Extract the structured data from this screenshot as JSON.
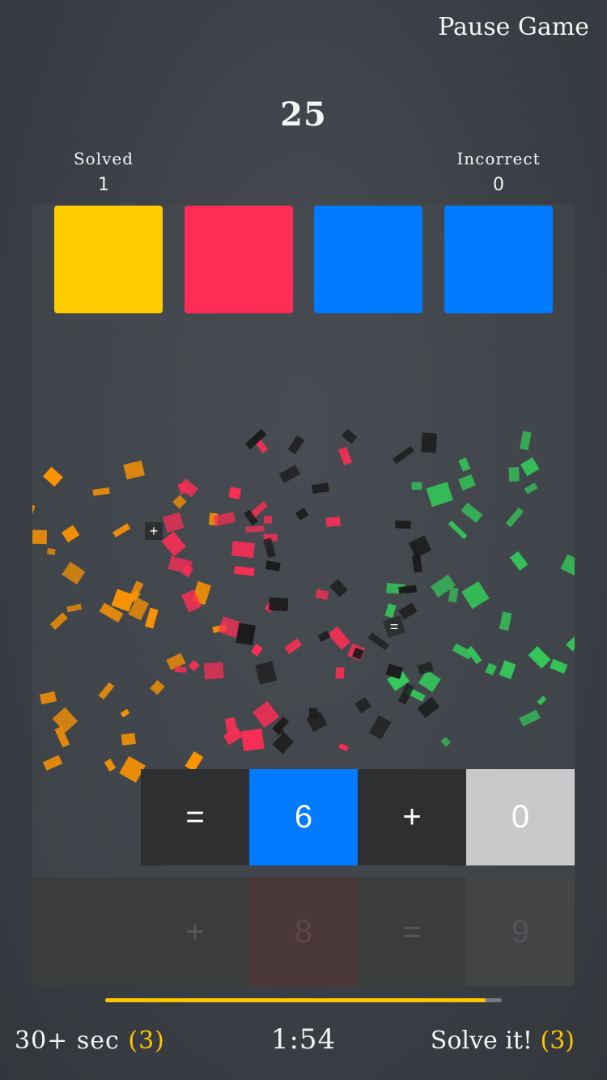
{
  "header": {
    "pause_label": "Pause Game",
    "score": "25"
  },
  "stats": {
    "solved_label": "Solved",
    "solved_value": "1",
    "incorrect_label": "Incorrect",
    "incorrect_value": "0"
  },
  "targets": [
    {
      "color": "#ffcc00"
    },
    {
      "color": "#ff2d55"
    },
    {
      "color": "#007aff"
    },
    {
      "color": "#007aff"
    }
  ],
  "tiles_top": [
    {
      "symbol": "=",
      "kind": "operator"
    },
    {
      "symbol": "6",
      "kind": "number-blue"
    },
    {
      "symbol": "+",
      "kind": "operator"
    },
    {
      "symbol": "0",
      "kind": "number-gray"
    }
  ],
  "tiles_bottom": [
    {
      "symbol": "",
      "kind": "empty"
    },
    {
      "symbol": "+",
      "kind": "operator-dim"
    },
    {
      "symbol": "8",
      "kind": "number-red-dim"
    },
    {
      "symbol": "=",
      "kind": "operator-dim"
    },
    {
      "symbol": "9",
      "kind": "number-gray-dim"
    }
  ],
  "progress": {
    "fraction": 0.96,
    "color": "#ffc600"
  },
  "footer": {
    "bonus_label": "30+ sec",
    "bonus_count": "(3)",
    "timer": "1:54",
    "solve_label": "Solve it!",
    "solve_count": "(3)"
  },
  "confetti_symbols": [
    "+",
    "="
  ]
}
